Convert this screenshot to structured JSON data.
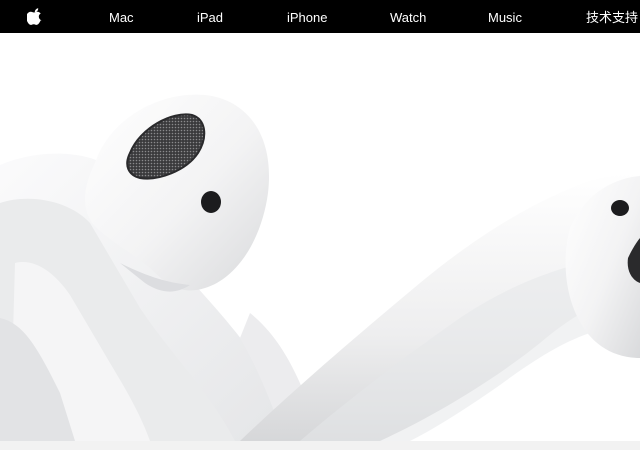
{
  "nav": {
    "logo_icon": "apple-logo-icon",
    "items": [
      {
        "label": "Mac"
      },
      {
        "label": "iPad"
      },
      {
        "label": "iPhone"
      },
      {
        "label": "Watch"
      },
      {
        "label": "Music"
      },
      {
        "label": "技术支持"
      }
    ]
  },
  "hero": {
    "image": "airpods-product-image"
  },
  "colors": {
    "nav_background": "#000000",
    "nav_text": "#ffffff",
    "page_background": "#ffffff"
  }
}
